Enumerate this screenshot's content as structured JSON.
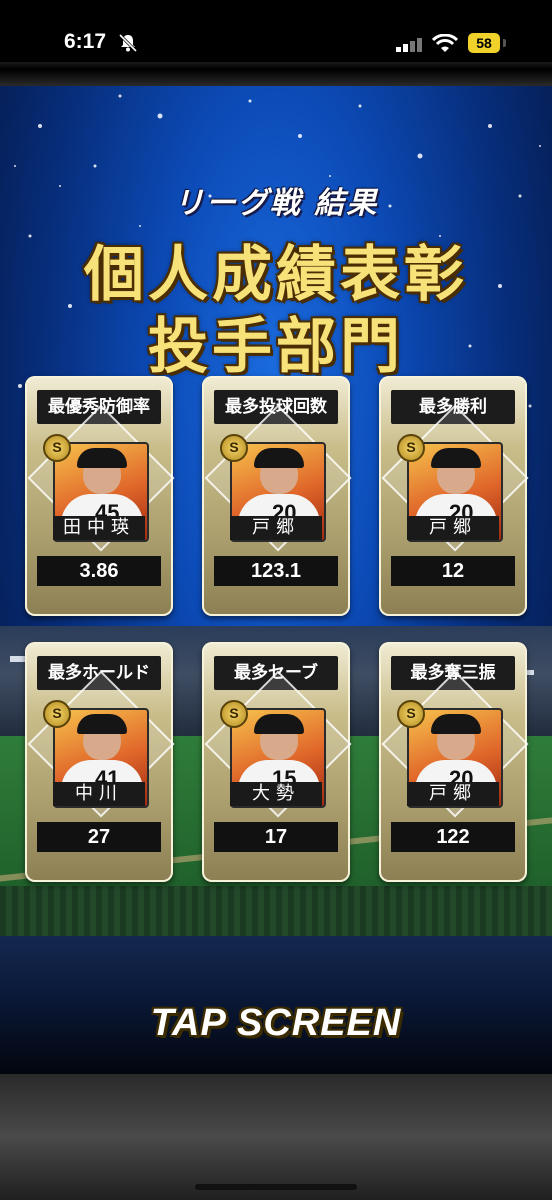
{
  "status_bar": {
    "time": "6:17",
    "battery": "58"
  },
  "header": {
    "subtitle": "リーグ戦 結果",
    "title_line1": "個人成績表彰",
    "title_line2": "投手部門"
  },
  "cards": [
    {
      "title": "最優秀防御率",
      "player": "田中瑛",
      "value": "3.86",
      "number": "45"
    },
    {
      "title": "最多投球回数",
      "player": "戸郷",
      "value": "123.1",
      "number": "20"
    },
    {
      "title": "最多勝利",
      "player": "戸郷",
      "value": "12",
      "number": "20"
    },
    {
      "title": "最多ホールド",
      "player": "中川",
      "value": "27",
      "number": "41"
    },
    {
      "title": "最多セーブ",
      "player": "大勢",
      "value": "17",
      "number": "15"
    },
    {
      "title": "最多奪三振",
      "player": "戸郷",
      "value": "122",
      "number": "20"
    }
  ],
  "badge_label": "S",
  "footer": {
    "tap_label": "TAP SCREEN"
  },
  "colors": {
    "title_gold": "#f7e27a",
    "sky_blue": "#0c4bb7",
    "battery_yellow": "#f0d22a"
  }
}
